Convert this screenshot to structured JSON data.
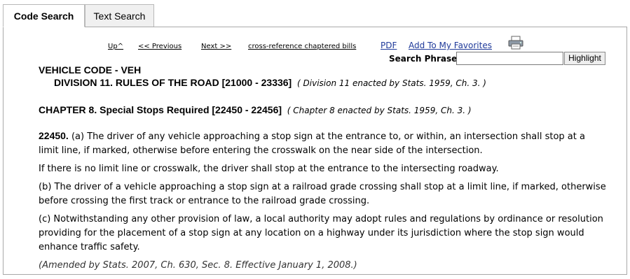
{
  "tabs": [
    {
      "label": "Code Search",
      "active": true
    },
    {
      "label": "Text Search",
      "active": false
    }
  ],
  "nav": {
    "up": "Up^",
    "previous": "<< Previous",
    "next": "Next >>",
    "cross_reference": "cross-reference chaptered bills",
    "pdf": "PDF",
    "favorites": "Add To My Favorites",
    "print_icon": "printer-icon"
  },
  "search": {
    "label": "Search Phrase:",
    "value": "",
    "button": "Highlight"
  },
  "code": {
    "title": "VEHICLE CODE - VEH",
    "division": "DIVISION 11. RULES OF THE ROAD [21000 - 23336]",
    "division_note": "( Division 11 enacted by Stats. 1959, Ch. 3. )",
    "chapter": "CHAPTER 8. Special Stops Required [22450 - 22456]",
    "chapter_note": "( Chapter 8 enacted by Stats. 1959, Ch. 3. )"
  },
  "section": {
    "number": "22450.",
    "paragraphs": [
      "(a) The driver of any vehicle approaching a stop sign at the entrance to, or within, an intersection shall stop at a limit line, if marked, otherwise before entering the crosswalk on the near side of the intersection.",
      "If there is no limit line or crosswalk, the driver shall stop at the entrance to the intersecting roadway.",
      "(b) The driver of a vehicle approaching a stop sign at a railroad grade crossing shall stop at a limit line, if marked, otherwise before crossing the first track or entrance to the railroad grade crossing.",
      "(c) Notwithstanding any other provision of law, a local authority may adopt rules and regulations by ordinance or resolution providing for the placement of a stop sign at any location on a highway under its jurisdiction where the stop sign would enhance traffic safety."
    ],
    "history": "(Amended by Stats. 2007, Ch. 630, Sec. 8. Effective January 1, 2008.)"
  },
  "colors": {
    "link": "#1f3a9a",
    "border": "#a9a9a9",
    "tab_inactive": "#f0f0f0"
  }
}
